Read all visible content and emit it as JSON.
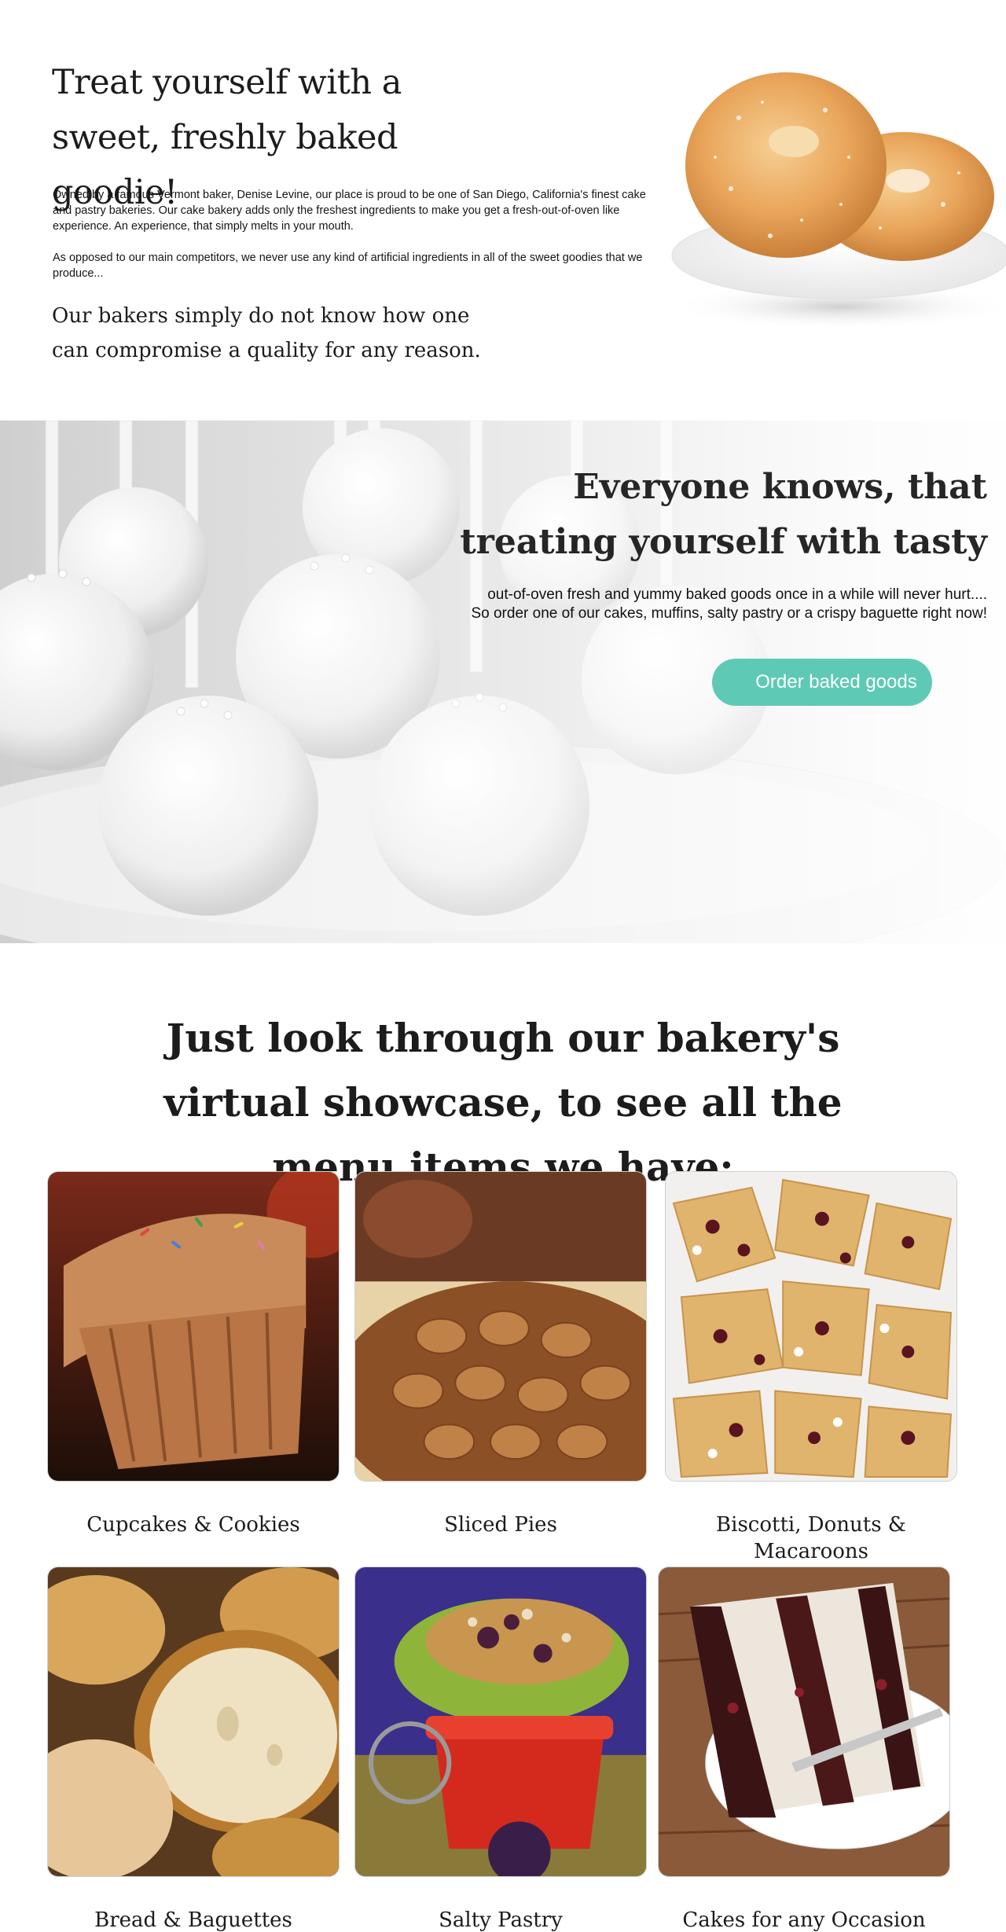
{
  "intro": {
    "title": "Treat yourself with a sweet, freshly baked goodie!",
    "paragraph1": "Owned by a famous Vermont baker, Denise Levine, our place is proud to be one of San Diego, California's finest cake and pastry bakeries. Our cake bakery adds only the freshest ingredients to make you get a fresh-out-of-oven like experience. An experience, that simply melts in your mouth.",
    "paragraph2": "As opposed to our main competitors, we never use any kind of artificial ingredients in all of the sweet goodies that we produce...",
    "quote": "Our bakers simply do not know how one can compromise a quality for any reason.",
    "image_icon": "sugar-donuts-image"
  },
  "hero": {
    "title": "Everyone knows, that treating yourself with tasty",
    "text_line1": "out-of-oven fresh and yummy baked goods once in a while will never hurt....",
    "text_line2": "So order one of our cakes, muffins, salty pastry or a crispy baguette right now!",
    "button_label": "Order baked goods",
    "button_color": "#5ecab5",
    "image_icon": "cake-pops-image"
  },
  "showcase": {
    "title": "Just look through our bakery's virtual showcase, to see all the menu items we have:",
    "items": [
      {
        "label": "Cupcakes & Cookies",
        "icon": "cupcake-image"
      },
      {
        "label": "Sliced Pies",
        "icon": "pie-image"
      },
      {
        "label": "Biscotti, Donuts & Macaroons",
        "icon": "biscotti-image"
      },
      {
        "label": "Bread & Baguettes",
        "icon": "bread-image"
      },
      {
        "label": "Salty Pastry",
        "icon": "salty-pastry-image"
      },
      {
        "label": "Cakes for any Occasion",
        "icon": "cake-slice-image"
      }
    ]
  }
}
